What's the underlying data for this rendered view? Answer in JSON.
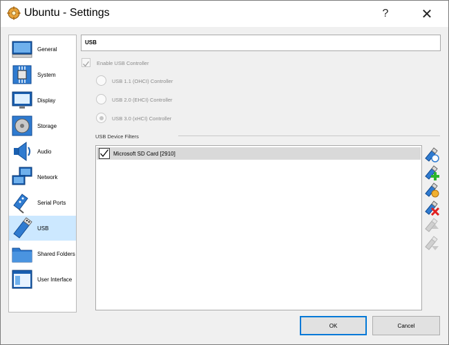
{
  "window": {
    "title": "Ubuntu - Settings",
    "help_label": "?",
    "close_label": "✕"
  },
  "sidebar": {
    "items": [
      {
        "label": "General",
        "icon": "general-icon"
      },
      {
        "label": "System",
        "icon": "system-icon"
      },
      {
        "label": "Display",
        "icon": "display-icon"
      },
      {
        "label": "Storage",
        "icon": "storage-icon"
      },
      {
        "label": "Audio",
        "icon": "audio-icon"
      },
      {
        "label": "Network",
        "icon": "network-icon"
      },
      {
        "label": "Serial Ports",
        "icon": "serial-ports-icon"
      },
      {
        "label": "USB",
        "icon": "usb-icon",
        "selected": true
      },
      {
        "label": "Shared Folders",
        "icon": "shared-folders-icon"
      },
      {
        "label": "User Interface",
        "icon": "user-interface-icon"
      }
    ]
  },
  "page": {
    "title": "USB",
    "enable_usb": {
      "label": "Enable USB Controller",
      "checked": true,
      "enabled": false
    },
    "controllers": [
      {
        "label": "USB 1.1 (OHCI) Controller",
        "checked": false
      },
      {
        "label": "USB 2.0 (EHCI) Controller",
        "checked": false
      },
      {
        "label": "USB 3.0 (xHCI) Controller",
        "checked": true
      }
    ],
    "filters_label": "USB Device Filters",
    "filters": [
      {
        "label": "Microsoft SD Card [2910]",
        "checked": true
      }
    ],
    "tools": [
      "add-filter-icon",
      "add-from-device-icon",
      "edit-filter-icon",
      "remove-filter-icon",
      "move-up-icon",
      "move-down-icon"
    ]
  },
  "buttons": {
    "ok": "OK",
    "cancel": "Cancel"
  },
  "colors": {
    "selection": "#cce8ff",
    "focus_border": "#0078d7",
    "row_highlight": "#d9d9d9"
  }
}
